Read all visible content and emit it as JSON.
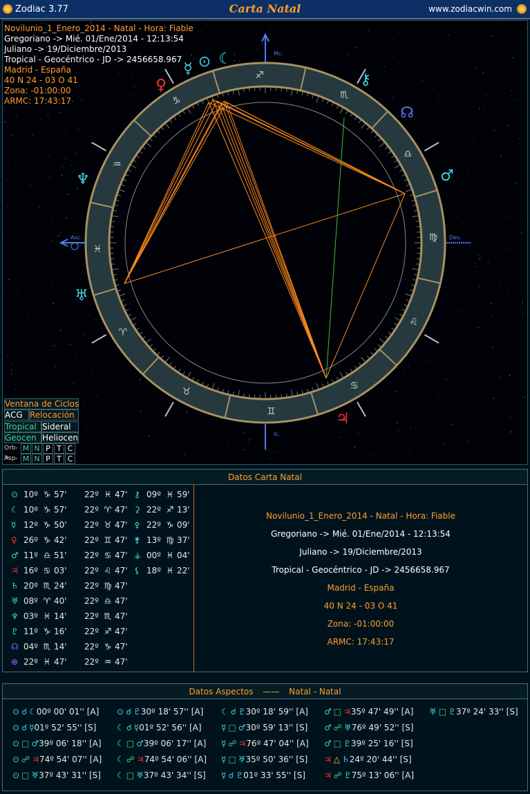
{
  "app": {
    "title": "Zodiac 3.77",
    "chart_title": "Carta Natal",
    "website": "www.zodiacwin.com"
  },
  "info": [
    {
      "text": "Novilunio_1_Enero_2014 - Natal - Hora: Fiable",
      "color": "#ff9d2e"
    },
    {
      "text": "Gregoriano -> Mié. 01/Ene/2014 - 12:13:54",
      "color": "#ffffff"
    },
    {
      "text": "Juliano -> 19/Diciembre/2013",
      "color": "#ffffff"
    },
    {
      "text": "Tropical - Geocéntrico - JD -> 2456658.967",
      "color": "#ffffff"
    },
    {
      "text": "Madrid - España",
      "color": "#ff9d2e"
    },
    {
      "text": "40 N 24 - 03 O 41",
      "color": "#ff9d2e"
    },
    {
      "text": "Zona: -01:00:00",
      "color": "#ff9d2e"
    },
    {
      "text": "ARMC: 17:43:17",
      "color": "#ff9d2e"
    }
  ],
  "wheel": {
    "axis_labels": {
      "mc": "Mc.",
      "asc": "Asc.",
      "des": "Des.",
      "ic": "Ic."
    },
    "signs": [
      "♈",
      "♉",
      "♊",
      "♋",
      "♌",
      "♍",
      "♎",
      "♏",
      "♐",
      "♑",
      "♒",
      "♓"
    ],
    "planets_outer": [
      {
        "glyph": "☿",
        "color": "#3fd7e2"
      },
      {
        "glyph": "⊙",
        "color": "#3fd7e2"
      },
      {
        "glyph": "☾",
        "color": "#3fd7e2"
      },
      {
        "glyph": "♀",
        "color": "#ff3030"
      },
      {
        "glyph": "⚷",
        "color": "#3fd7e2"
      },
      {
        "glyph": "☊",
        "color": "#5a78ff"
      },
      {
        "glyph": "♂",
        "color": "#3fd7e2"
      },
      {
        "glyph": "♆",
        "color": "#3fd7e2"
      },
      {
        "glyph": "♅",
        "color": "#3fd7e2"
      },
      {
        "glyph": "♃",
        "color": "#ff3030"
      }
    ]
  },
  "controls": {
    "ciclos": "Ventana de Ciclos",
    "acg": "ACG",
    "relocacion": "Relocación",
    "tropical": "Tropical",
    "sideral": "Sideral",
    "geocen": "Geocen",
    "helioc": "Heliocen",
    "orb_label": "Orb->",
    "asp_label": "Asp->",
    "orb_buttons": [
      "M",
      "N",
      "P",
      "T",
      "C"
    ],
    "asp_buttons": [
      "M",
      "N",
      "P",
      "T",
      "C"
    ]
  },
  "datos": {
    "title": "Datos Carta Natal",
    "planets": [
      {
        "g": "⊙",
        "gc": "#3fd7e2",
        "deg": "10º",
        "sign": "♑",
        "min": "57'"
      },
      {
        "g": "☾",
        "gc": "#3fd7e2",
        "deg": "10º",
        "sign": "♑",
        "min": "57'"
      },
      {
        "g": "☿",
        "gc": "#3fd7e2",
        "deg": "12º",
        "sign": "♑",
        "min": "50'"
      },
      {
        "g": "♀",
        "gc": "#ff3030",
        "deg": "26º",
        "sign": "♑",
        "min": "42'"
      },
      {
        "g": "♂",
        "gc": "#3fd7e2",
        "deg": "11º",
        "sign": "♎",
        "min": "51'"
      },
      {
        "g": "♃",
        "gc": "#ff3030",
        "deg": "16º",
        "sign": "♋",
        "min": "03'"
      },
      {
        "g": "♄",
        "gc": "#3fd7e2",
        "deg": "20º",
        "sign": "♏",
        "min": "24'"
      },
      {
        "g": "♅",
        "gc": "#3fd7e2",
        "deg": "08º",
        "sign": "♈",
        "min": "40'"
      },
      {
        "g": "♆",
        "gc": "#3fd7e2",
        "deg": "03º",
        "sign": "♓",
        "min": "14'"
      },
      {
        "g": "♇",
        "gc": "#3fd7e2",
        "deg": "11º",
        "sign": "♑",
        "min": "16'"
      },
      {
        "g": "☊",
        "gc": "#5a78ff",
        "deg": "04º",
        "sign": "♏",
        "min": "14'"
      },
      {
        "g": "⊕",
        "gc": "#b45cff",
        "deg": "22º",
        "sign": "♓",
        "min": "47'"
      }
    ],
    "houses": [
      {
        "deg": "22º",
        "sign": "♓",
        "min": "47'"
      },
      {
        "deg": "22º",
        "sign": "♈",
        "min": "47'"
      },
      {
        "deg": "22º",
        "sign": "♉",
        "min": "47'"
      },
      {
        "deg": "22º",
        "sign": "♊",
        "min": "47'"
      },
      {
        "deg": "22º",
        "sign": "♋",
        "min": "47'"
      },
      {
        "deg": "22º",
        "sign": "♌",
        "min": "47'"
      },
      {
        "deg": "22º",
        "sign": "♍",
        "min": "47'"
      },
      {
        "deg": "22º",
        "sign": "♎",
        "min": "47'"
      },
      {
        "deg": "22º",
        "sign": "♏",
        "min": "47'"
      },
      {
        "deg": "22º",
        "sign": "♐",
        "min": "47'"
      },
      {
        "deg": "22º",
        "sign": "♑",
        "min": "47'"
      },
      {
        "deg": "22º",
        "sign": "♒",
        "min": "47'"
      }
    ],
    "asteroids": [
      {
        "g": "⚷",
        "deg": "09º",
        "sign": "♓",
        "min": "59'"
      },
      {
        "g": "⚳",
        "deg": "22º",
        "sign": "♐",
        "min": "13'"
      },
      {
        "g": "⚴",
        "deg": "22º",
        "sign": "♑",
        "min": "09'"
      },
      {
        "g": "⚵",
        "deg": "13º",
        "sign": "♍",
        "min": "37'"
      },
      {
        "g": "⚶",
        "deg": "00º",
        "sign": "♓",
        "min": "04'"
      },
      {
        "g": "⚸",
        "deg": "18º",
        "sign": "♓",
        "min": "22'"
      }
    ]
  },
  "aspectos": {
    "title": "Datos Aspectos",
    "separator": "——",
    "subtitle": "Natal - Natal",
    "columns": [
      [
        {
          "p1": "⊙",
          "asp": "☌",
          "p2": "☾",
          "val": "00º 00' 01'' [A]"
        },
        {
          "p1": "⊙",
          "asp": "☌",
          "p2": "☿",
          "val": "01º 52' 55'' [S]"
        },
        {
          "p1": "⊙",
          "asp": "□",
          "p2": "♂",
          "val": "39º 06' 18'' [A]"
        },
        {
          "p1": "⊙",
          "asp": "☍",
          "p2": "♃",
          "val": "74º 54' 07'' [A]"
        },
        {
          "p1": "⊙",
          "asp": "□",
          "p2": "♅",
          "val": "37º 43' 31'' [S]"
        }
      ],
      [
        {
          "p1": "⊙",
          "asp": "☌",
          "p2": "♇",
          "val": "30º 18' 57'' [A]"
        },
        {
          "p1": "☾",
          "asp": "☌",
          "p2": "☿",
          "val": "01º 52' 56'' [A]"
        },
        {
          "p1": "☾",
          "asp": "□",
          "p2": "♂",
          "val": "39º 06' 17'' [A]"
        },
        {
          "p1": "☾",
          "asp": "☍",
          "p2": "♃",
          "val": "74º 54' 06'' [A]"
        },
        {
          "p1": "☾",
          "asp": "□",
          "p2": "♅",
          "val": "37º 43' 34'' [S]"
        }
      ],
      [
        {
          "p1": "☾",
          "asp": "☌",
          "p2": "♇",
          "val": "30º 18' 59'' [A]"
        },
        {
          "p1": "☿",
          "asp": "□",
          "p2": "♂",
          "val": "30º 59' 13'' [S]"
        },
        {
          "p1": "☿",
          "asp": "☍",
          "p2": "♃",
          "val": "76º 47' 04'' [A]"
        },
        {
          "p1": "☿",
          "asp": "□",
          "p2": "♅",
          "val": "35º 50' 36'' [S]"
        },
        {
          "p1": "☿",
          "asp": "☌",
          "p2": "♇",
          "val": "01º 33' 55'' [S]"
        }
      ],
      [
        {
          "p1": "♂",
          "asp": "□",
          "p2": "♃",
          "val": "35º 47' 49'' [A]"
        },
        {
          "p1": "♂",
          "asp": "☍",
          "p2": "♅",
          "val": "76º 49' 52'' [S]"
        },
        {
          "p1": "♂",
          "asp": "□",
          "p2": "♇",
          "val": "39º 25' 16'' [S]"
        },
        {
          "p1": "♃",
          "asp": "△",
          "p2": "♄",
          "val": "24º 20' 44'' [S]"
        },
        {
          "p1": "♃",
          "asp": "☍",
          "p2": "♇",
          "val": "75º 13' 06'' [A]"
        }
      ],
      [
        {
          "p1": "♅",
          "asp": "□",
          "p2": "♇",
          "val": "37º 24' 33'' [S]"
        }
      ]
    ]
  }
}
